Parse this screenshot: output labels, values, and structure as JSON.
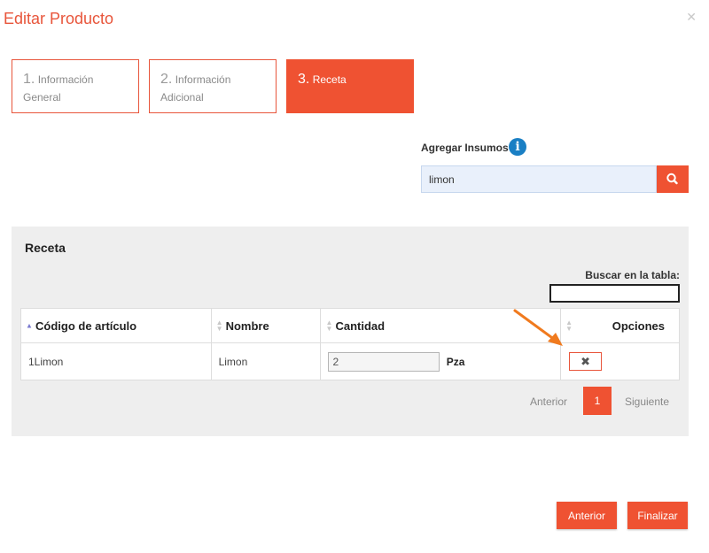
{
  "modal": {
    "title": "Editar Producto",
    "close_icon": "close-icon"
  },
  "steps": [
    {
      "number": "1.",
      "label": "Información General",
      "active": false
    },
    {
      "number": "2.",
      "label": "Información Adicional",
      "active": false
    },
    {
      "number": "3.",
      "label": "Receta",
      "active": true
    }
  ],
  "add_supplies": {
    "label": "Agregar Insumos",
    "info_icon": "info-icon",
    "search_value": "limon",
    "search_icon": "search-icon"
  },
  "recipe": {
    "title": "Receta",
    "table_search_label": "Buscar en la tabla:",
    "table_search_value": "",
    "columns": [
      "Código de artículo",
      "Nombre",
      "Cantidad",
      "Opciones"
    ],
    "rows": [
      {
        "code": "1Limon",
        "name": "Limon",
        "quantity": "2",
        "unit": "Pza",
        "delete_label": "✖"
      }
    ],
    "pagination": {
      "previous": "Anterior",
      "current": "1",
      "next": "Siguiente"
    }
  },
  "footer": {
    "previous_label": "Anterior",
    "finish_label": "Finalizar"
  },
  "colors": {
    "accent": "#ef5232",
    "info_blue": "#1a7fc4",
    "panel_bg": "#eeeeee"
  }
}
